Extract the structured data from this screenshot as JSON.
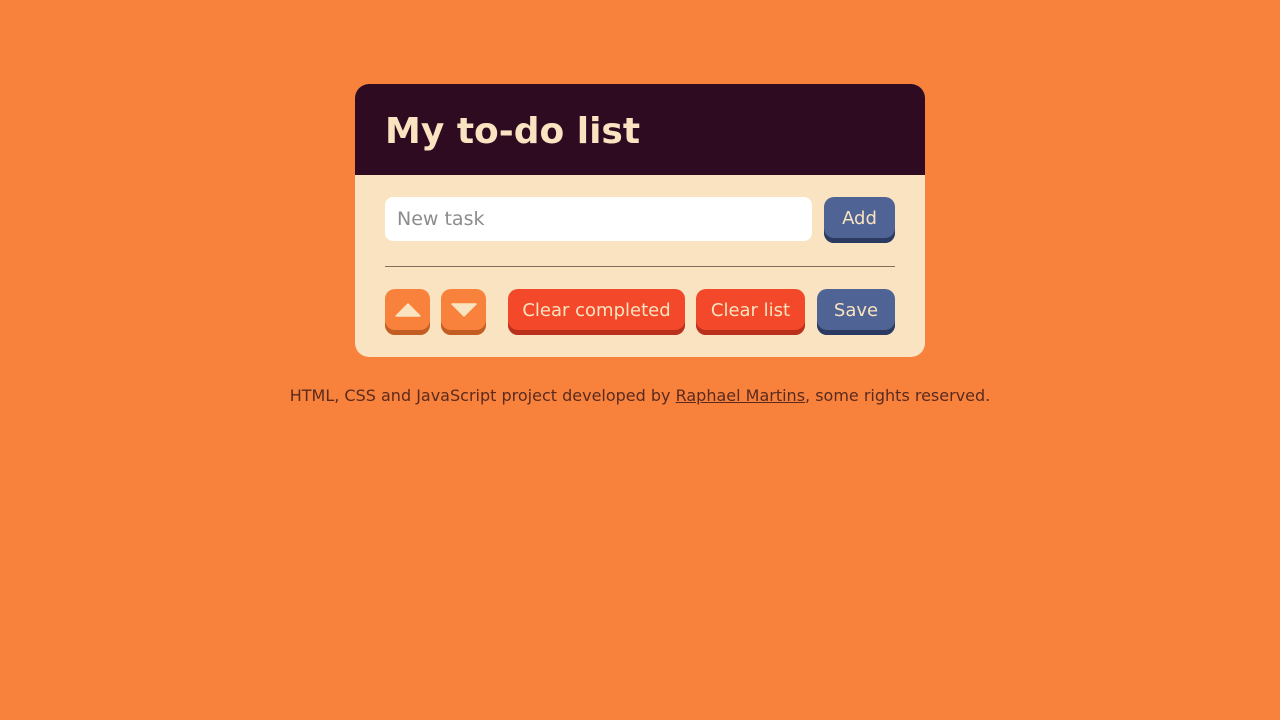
{
  "card": {
    "title": "My to-do list"
  },
  "input": {
    "placeholder": "New task",
    "value": ""
  },
  "buttons": {
    "add": "Add",
    "move_up_icon": "triangle-up-icon",
    "move_down_icon": "triangle-down-icon",
    "clear_completed": "Clear completed",
    "clear_list": "Clear list",
    "save": "Save"
  },
  "footer": {
    "prefix": "HTML, CSS and JavaScript project developed by ",
    "author_link": "Raphael Martins",
    "suffix": ", some rights reserved."
  },
  "colors": {
    "background": "#f8823c",
    "header": "#2e0b21",
    "card_body": "#f9e3c0",
    "blue_button": "#4f6394",
    "red_button": "#f4482a"
  }
}
